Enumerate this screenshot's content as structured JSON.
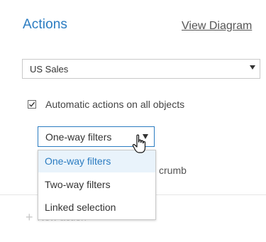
{
  "panel": {
    "title": "Actions",
    "view_link": "View Diagram"
  },
  "sheet_select": {
    "value": "US Sales",
    "icon": "chevron-down-icon"
  },
  "auto_actions": {
    "checked": true,
    "label": "Automatic actions on all objects"
  },
  "mode_select": {
    "value": "One-way filters",
    "icon": "chevron-down-icon",
    "expanded": true,
    "options": [
      "One-way filters",
      "Two-way filters",
      "Linked selection"
    ],
    "selected_index": 0
  },
  "obscured_text": "crumb",
  "new_action": {
    "label": "New action",
    "icon": "plus-icon"
  },
  "colors": {
    "accent": "#2b7cc1",
    "selected_bg": "#e9f3fb",
    "disabled": "#c8c8c8"
  }
}
